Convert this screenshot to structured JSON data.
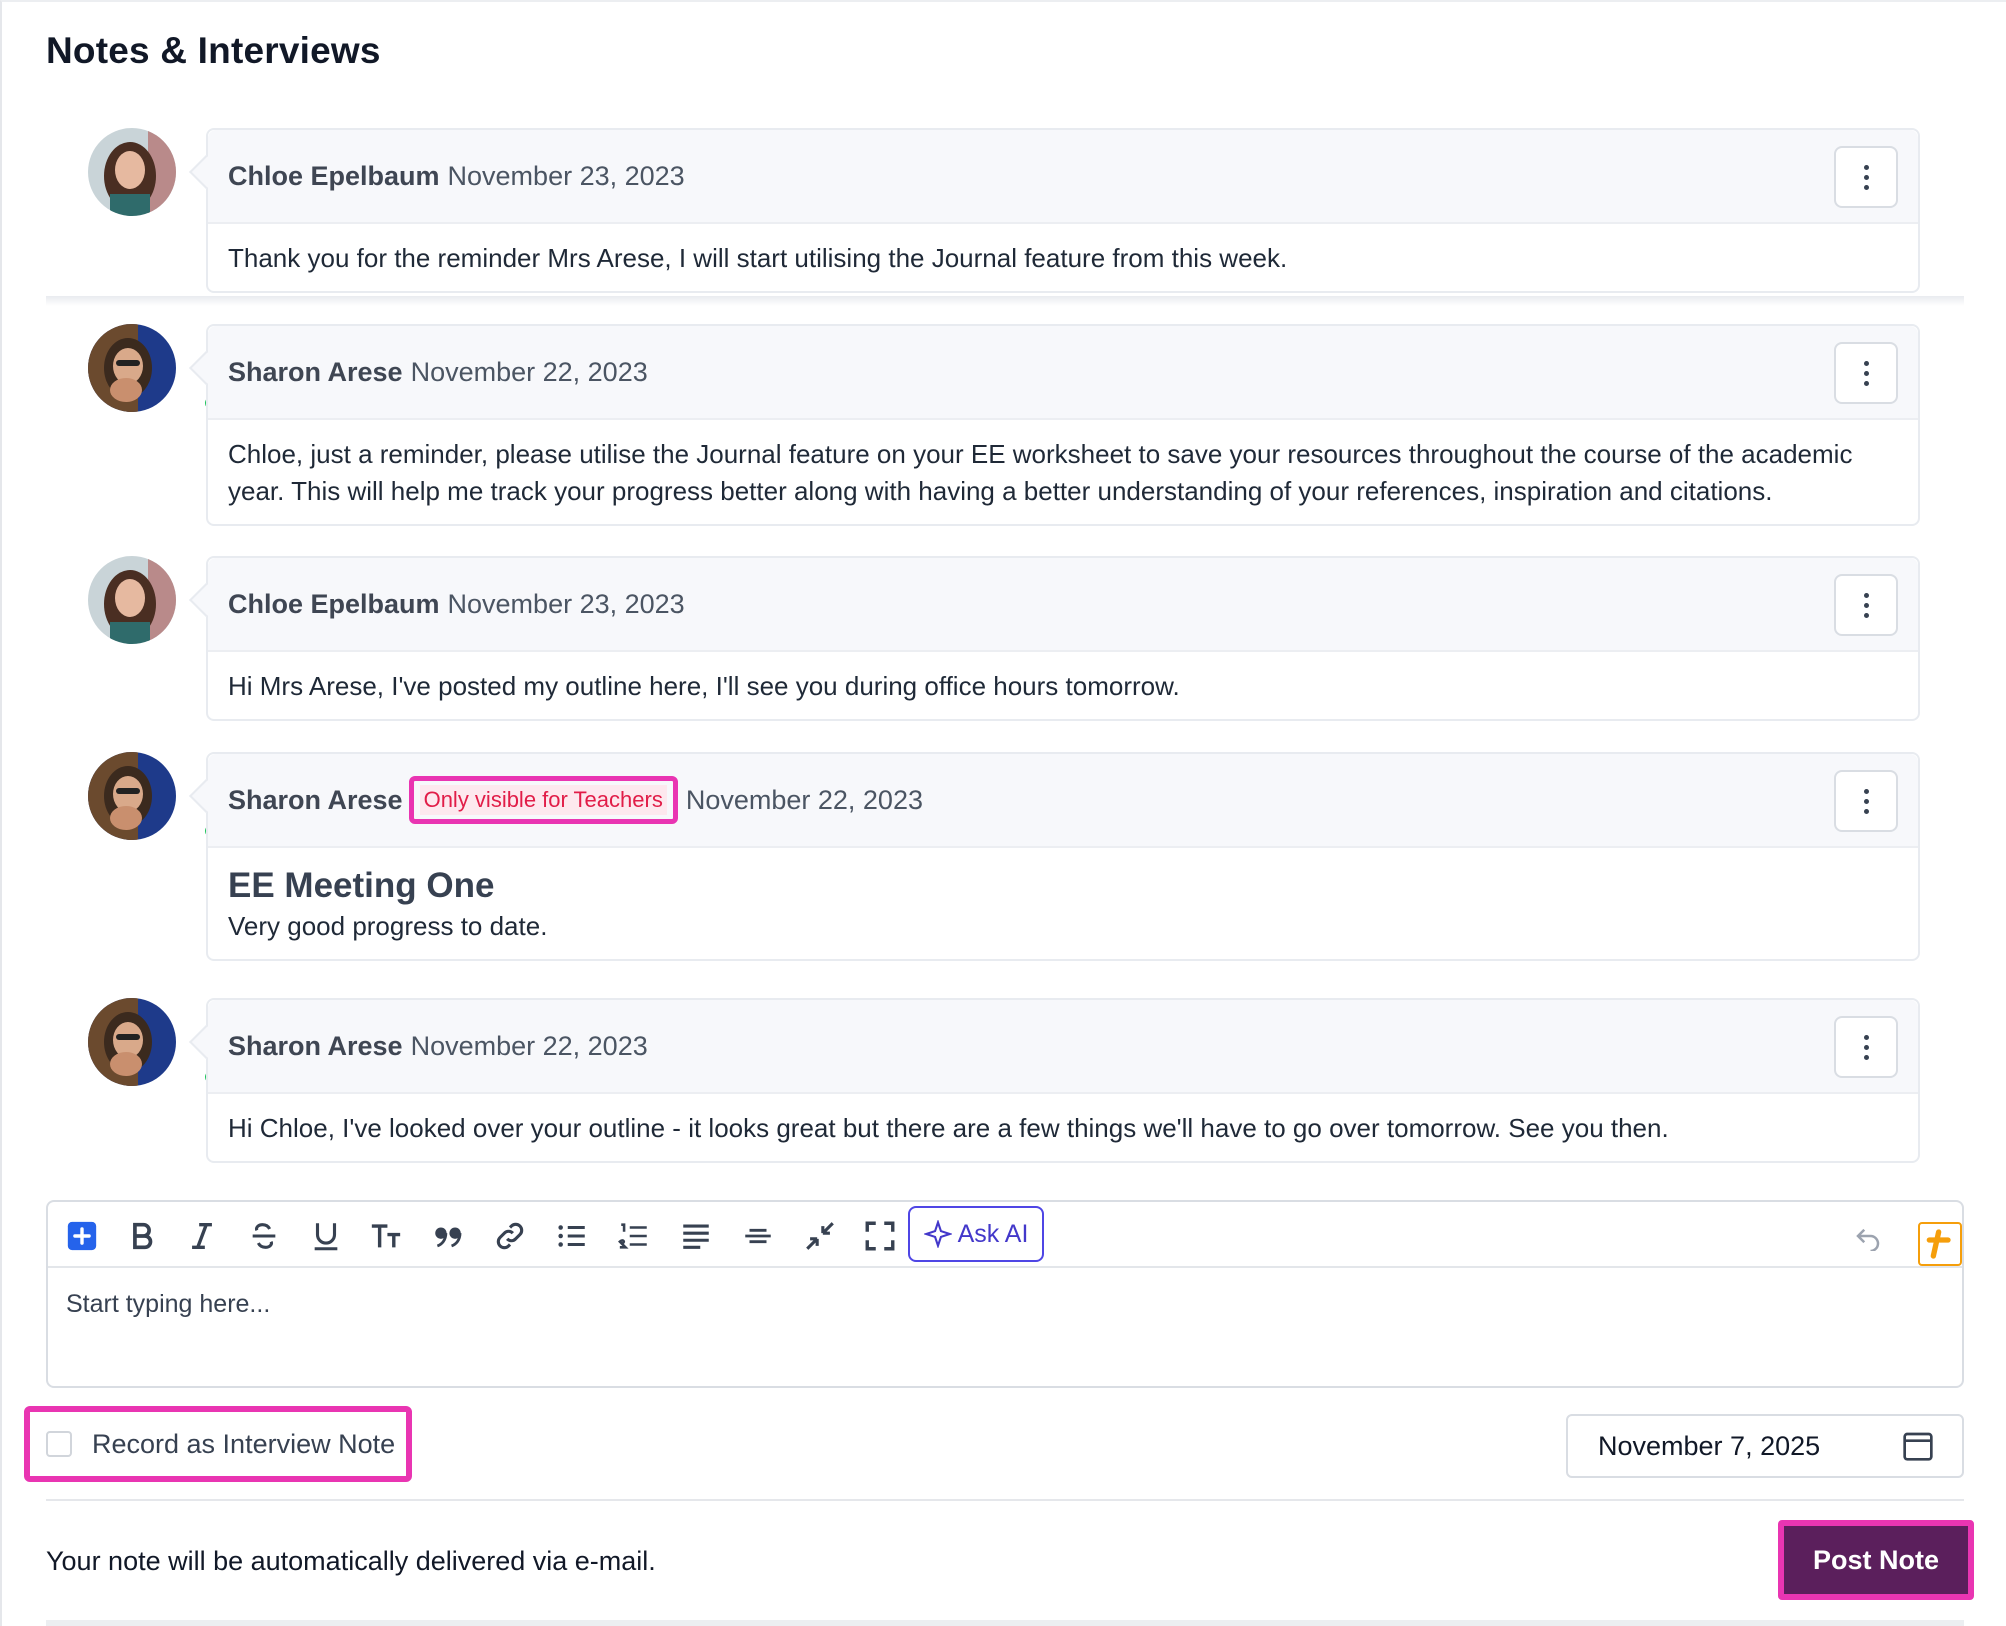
{
  "page": {
    "title": "Notes & Interviews"
  },
  "notes": [
    {
      "author": "Chloe Epelbaum",
      "date": "November 23, 2023",
      "avatar": "chloe-avatar",
      "online": false,
      "body": "Thank you for the reminder Mrs Arese, I will start utilising the Journal feature from this week."
    },
    {
      "author": "Sharon Arese",
      "date": "November 22, 2023",
      "avatar": "sharon-avatar",
      "online": true,
      "body": "Chloe, just a reminder, please utilise the Journal feature on your EE worksheet to save your resources throughout the course of the academic year. This will help me track your progress better along with having a better understanding of your references, inspiration and citations."
    },
    {
      "author": "Chloe Epelbaum",
      "date": "November 23, 2023",
      "avatar": "chloe-avatar",
      "online": false,
      "body": "Hi Mrs Arese, I've posted my outline here, I'll see you during office hours tomorrow."
    },
    {
      "author": "Sharon Arese",
      "badge": "Only visible for Teachers",
      "date": "November 22, 2023",
      "avatar": "sharon-avatar",
      "online": true,
      "heading": "EE Meeting One",
      "body": "Very good progress to date."
    },
    {
      "author": "Sharon Arese",
      "date": "November 22, 2023",
      "avatar": "sharon-avatar",
      "online": true,
      "body": "Hi Chloe, I've looked over your outline - it looks great but there are a few things we'll have to go over tomorrow. See you then."
    }
  ],
  "editor": {
    "toolbar": [
      "plus-square-icon",
      "bold-icon",
      "italic-icon",
      "strikethrough-icon",
      "underline-icon",
      "text-size-icon",
      "quote-icon",
      "link-icon",
      "bullet-list-icon",
      "numbered-list-icon",
      "align-icon",
      "horizontal-rule-icon",
      "collapse-icon",
      "fullscreen-icon"
    ],
    "ask_ai_label": "Ask AI",
    "placeholder": "Start typing here..."
  },
  "interview": {
    "label": "Record as Interview Note",
    "checked": false
  },
  "date_field": {
    "value": "November 7, 2025"
  },
  "footer": {
    "text": "Your note will be automatically delivered via e-mail.",
    "post_label": "Post Note"
  },
  "colors": {
    "highlight": "#e935b2",
    "primary": "#5b1f5c",
    "ai": "#4338ca",
    "online": "#22c55e"
  }
}
